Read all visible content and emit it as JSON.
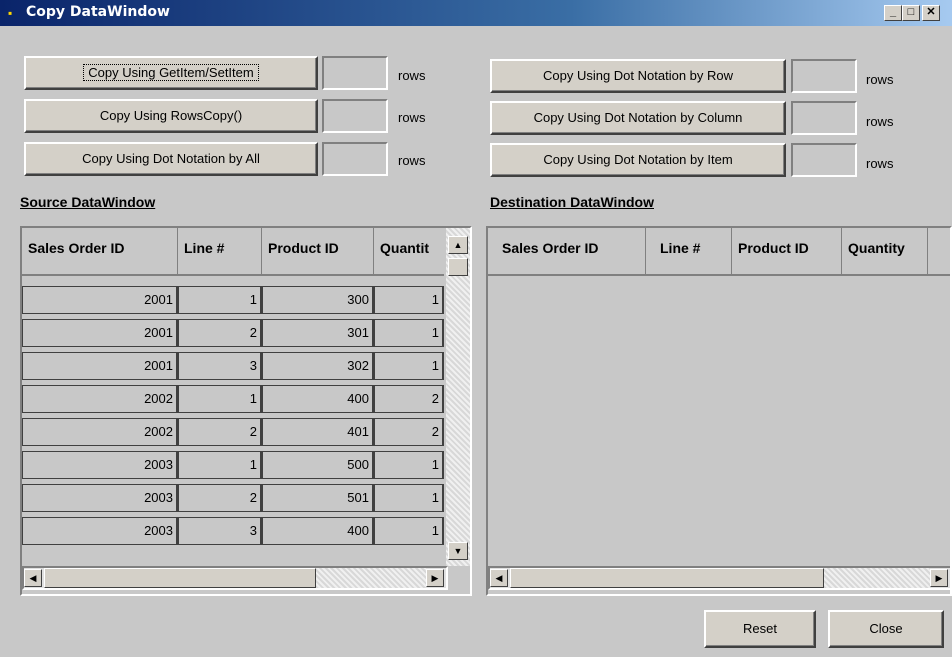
{
  "window": {
    "title": "Copy DataWindow"
  },
  "buttons": {
    "getitem": "Copy Using GetItem/SetItem",
    "rowscopy": "Copy Using RowsCopy()",
    "dot_all": "Copy Using Dot Notation by All",
    "dot_row": "Copy Using Dot Notation by Row",
    "dot_column": "Copy Using Dot Notation by Column",
    "dot_item": "Copy Using Dot Notation by Item",
    "reset": "Reset",
    "close": "Close"
  },
  "rows_label": "rows",
  "source": {
    "title": "Source DataWindow",
    "columns": [
      "Sales Order ID",
      "Line #",
      "Product ID",
      "Quantit"
    ],
    "rows": [
      [
        "2001",
        "1",
        "300",
        "1"
      ],
      [
        "2001",
        "2",
        "301",
        "1"
      ],
      [
        "2001",
        "3",
        "302",
        "1"
      ],
      [
        "2002",
        "1",
        "400",
        "2"
      ],
      [
        "2002",
        "2",
        "401",
        "2"
      ],
      [
        "2003",
        "1",
        "500",
        "1"
      ],
      [
        "2003",
        "2",
        "501",
        "1"
      ],
      [
        "2003",
        "3",
        "400",
        "1"
      ]
    ]
  },
  "destination": {
    "title": "Destination DataWindow",
    "columns": [
      "Sales Order ID",
      "Line #",
      "Product ID",
      "Quantity"
    ]
  }
}
